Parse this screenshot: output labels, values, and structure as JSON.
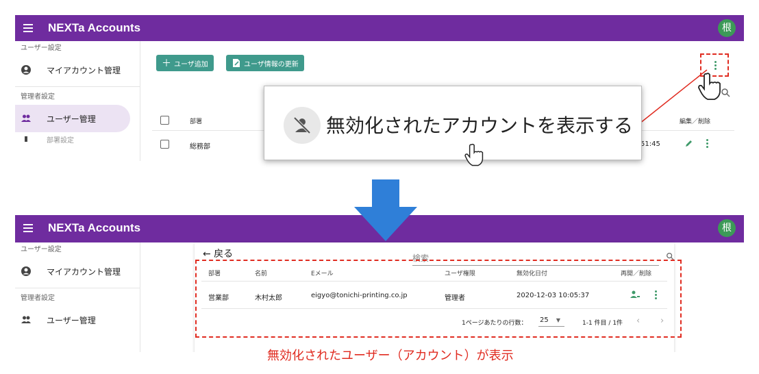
{
  "app": {
    "title": "NEXTa Accounts",
    "avatar_char": "根"
  },
  "sidebar": {
    "user_settings_label": "ユーザー設定",
    "my_account": "マイアカウント管理",
    "admin_settings_label": "管理者設定",
    "user_management": "ユーザー管理",
    "dept_settings_partial": "部署設定"
  },
  "top": {
    "add_user_button": "ユーザ追加",
    "update_user_button": "ユーザ情報の更新",
    "table_headers": {
      "dept": "部署",
      "edit_delete": "編集／削除"
    },
    "row": {
      "dept": "総務部",
      "time_partial": "51:45"
    }
  },
  "popup": {
    "menu_item": "無効化されたアカウントを表示する"
  },
  "bottom": {
    "back": "← 戻る",
    "search_placeholder": "検索",
    "headers": {
      "dept": "部署",
      "name": "名前",
      "email": "Eメール",
      "role": "ユーザ権限",
      "deactivated": "無効化日付",
      "actions": "再開／削除"
    },
    "row": {
      "dept": "営業部",
      "name": "木村太郎",
      "email": "eigyo@tonichi-printing.co.jp",
      "role": "管理者",
      "deactivated": "2020-12-03 10:05:37"
    },
    "pagination": {
      "rows_label": "1ページあたりの行数：",
      "rows_value": "25",
      "range": "1-1 件目 / 1件"
    }
  },
  "caption": "無効化されたユーザー（アカウント）が表示",
  "colors": {
    "appbar": "#6f2c9f",
    "accent": "#3f9a8c",
    "annotation": "#e02b20",
    "arrow": "#2f7fd8"
  }
}
